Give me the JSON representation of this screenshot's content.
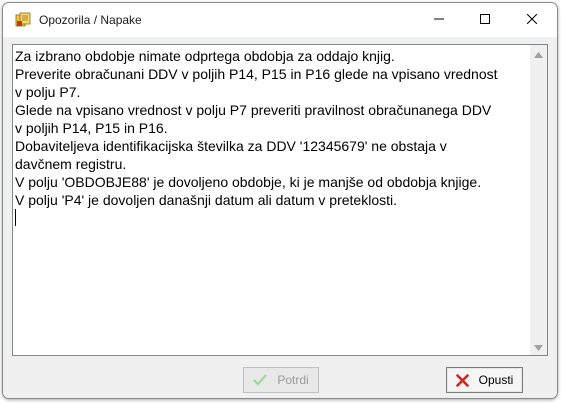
{
  "window": {
    "title": "Opozorila / Napake",
    "icons": {
      "app": "app-icon",
      "minimize": "minimize-icon",
      "maximize": "maximize-icon",
      "close": "close-icon"
    }
  },
  "message": {
    "lines": [
      "Za izbrano obdobje nimate odprtega obdobja za oddajo knjig.",
      "Preverite obračunani DDV v poljih P14, P15 in P16 glede na vpisano vrednost",
      "v polju P7.",
      "Glede na vpisano vrednost v polju P7 preveriti pravilnost obračunanega DDV",
      "v poljih P14, P15 in P16.",
      "Dobaviteljeva identifikacijska številka za DDV '12345679' ne obstaja v",
      "davčnem registru.",
      "V polju 'OBDOBJE88' je dovoljeno obdobje, ki je manjše od obdobja knjige.",
      "V polju 'P4' je dovoljen današnji datum ali datum v preteklosti."
    ]
  },
  "buttons": {
    "confirm": {
      "label": "Potrdi",
      "icon": "checkmark-icon",
      "enabled": false,
      "icon_color": "#9fd49f"
    },
    "cancel": {
      "label": "Opusti",
      "icon": "x-icon",
      "enabled": true,
      "icon_color": "#d9231e"
    }
  },
  "colors": {
    "dialog_background": "#f0f0f0",
    "textbox_background": "#ffffff",
    "titlebar_background": "#ffffff"
  }
}
